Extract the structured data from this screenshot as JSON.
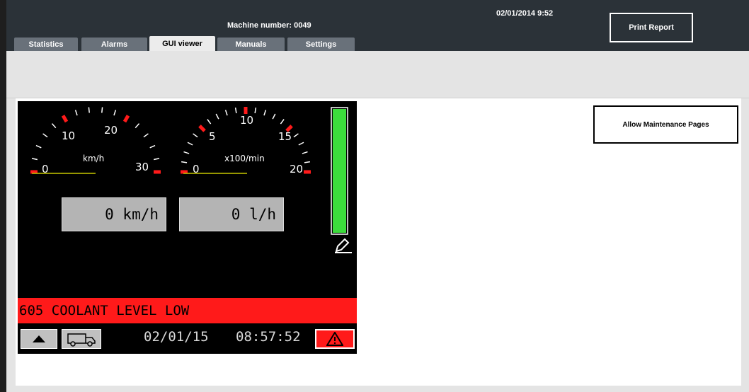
{
  "header": {
    "machine_number": "Machine number: 0049",
    "datetime": "02/01/2014 9:52",
    "print_report": "Print Report"
  },
  "tabs": [
    {
      "label": "Statistics",
      "active": false
    },
    {
      "label": "Alarms",
      "active": false
    },
    {
      "label": "GUI viewer",
      "active": true
    },
    {
      "label": "Manuals",
      "active": false
    },
    {
      "label": "Settings",
      "active": false
    }
  ],
  "side_panel": {
    "allow_maintenance": "Allow Maintenance Pages"
  },
  "gauges": {
    "speed": {
      "unit": "km/h",
      "ticks": [
        "0",
        "10",
        "20",
        "30"
      ],
      "value": 0
    },
    "rpm": {
      "unit": "x100/min",
      "ticks": [
        "0",
        "5",
        "10",
        "15",
        "20"
      ],
      "value": 0
    }
  },
  "readouts": {
    "speed_value": "0",
    "speed_unit": "km/h",
    "fuel_value": "0",
    "fuel_unit": "l/h"
  },
  "level_bar": {
    "fill": 1.0,
    "color": "#3cdc3c"
  },
  "alarm": {
    "text": "605 COOLANT LEVEL LOW",
    "color": "#ff1a1a"
  },
  "status": {
    "date": "02/01/15",
    "time": "08:57:52"
  },
  "icons": [
    "chevron-up-icon",
    "truck-icon",
    "warning-triangle-icon",
    "pencil-icon"
  ]
}
